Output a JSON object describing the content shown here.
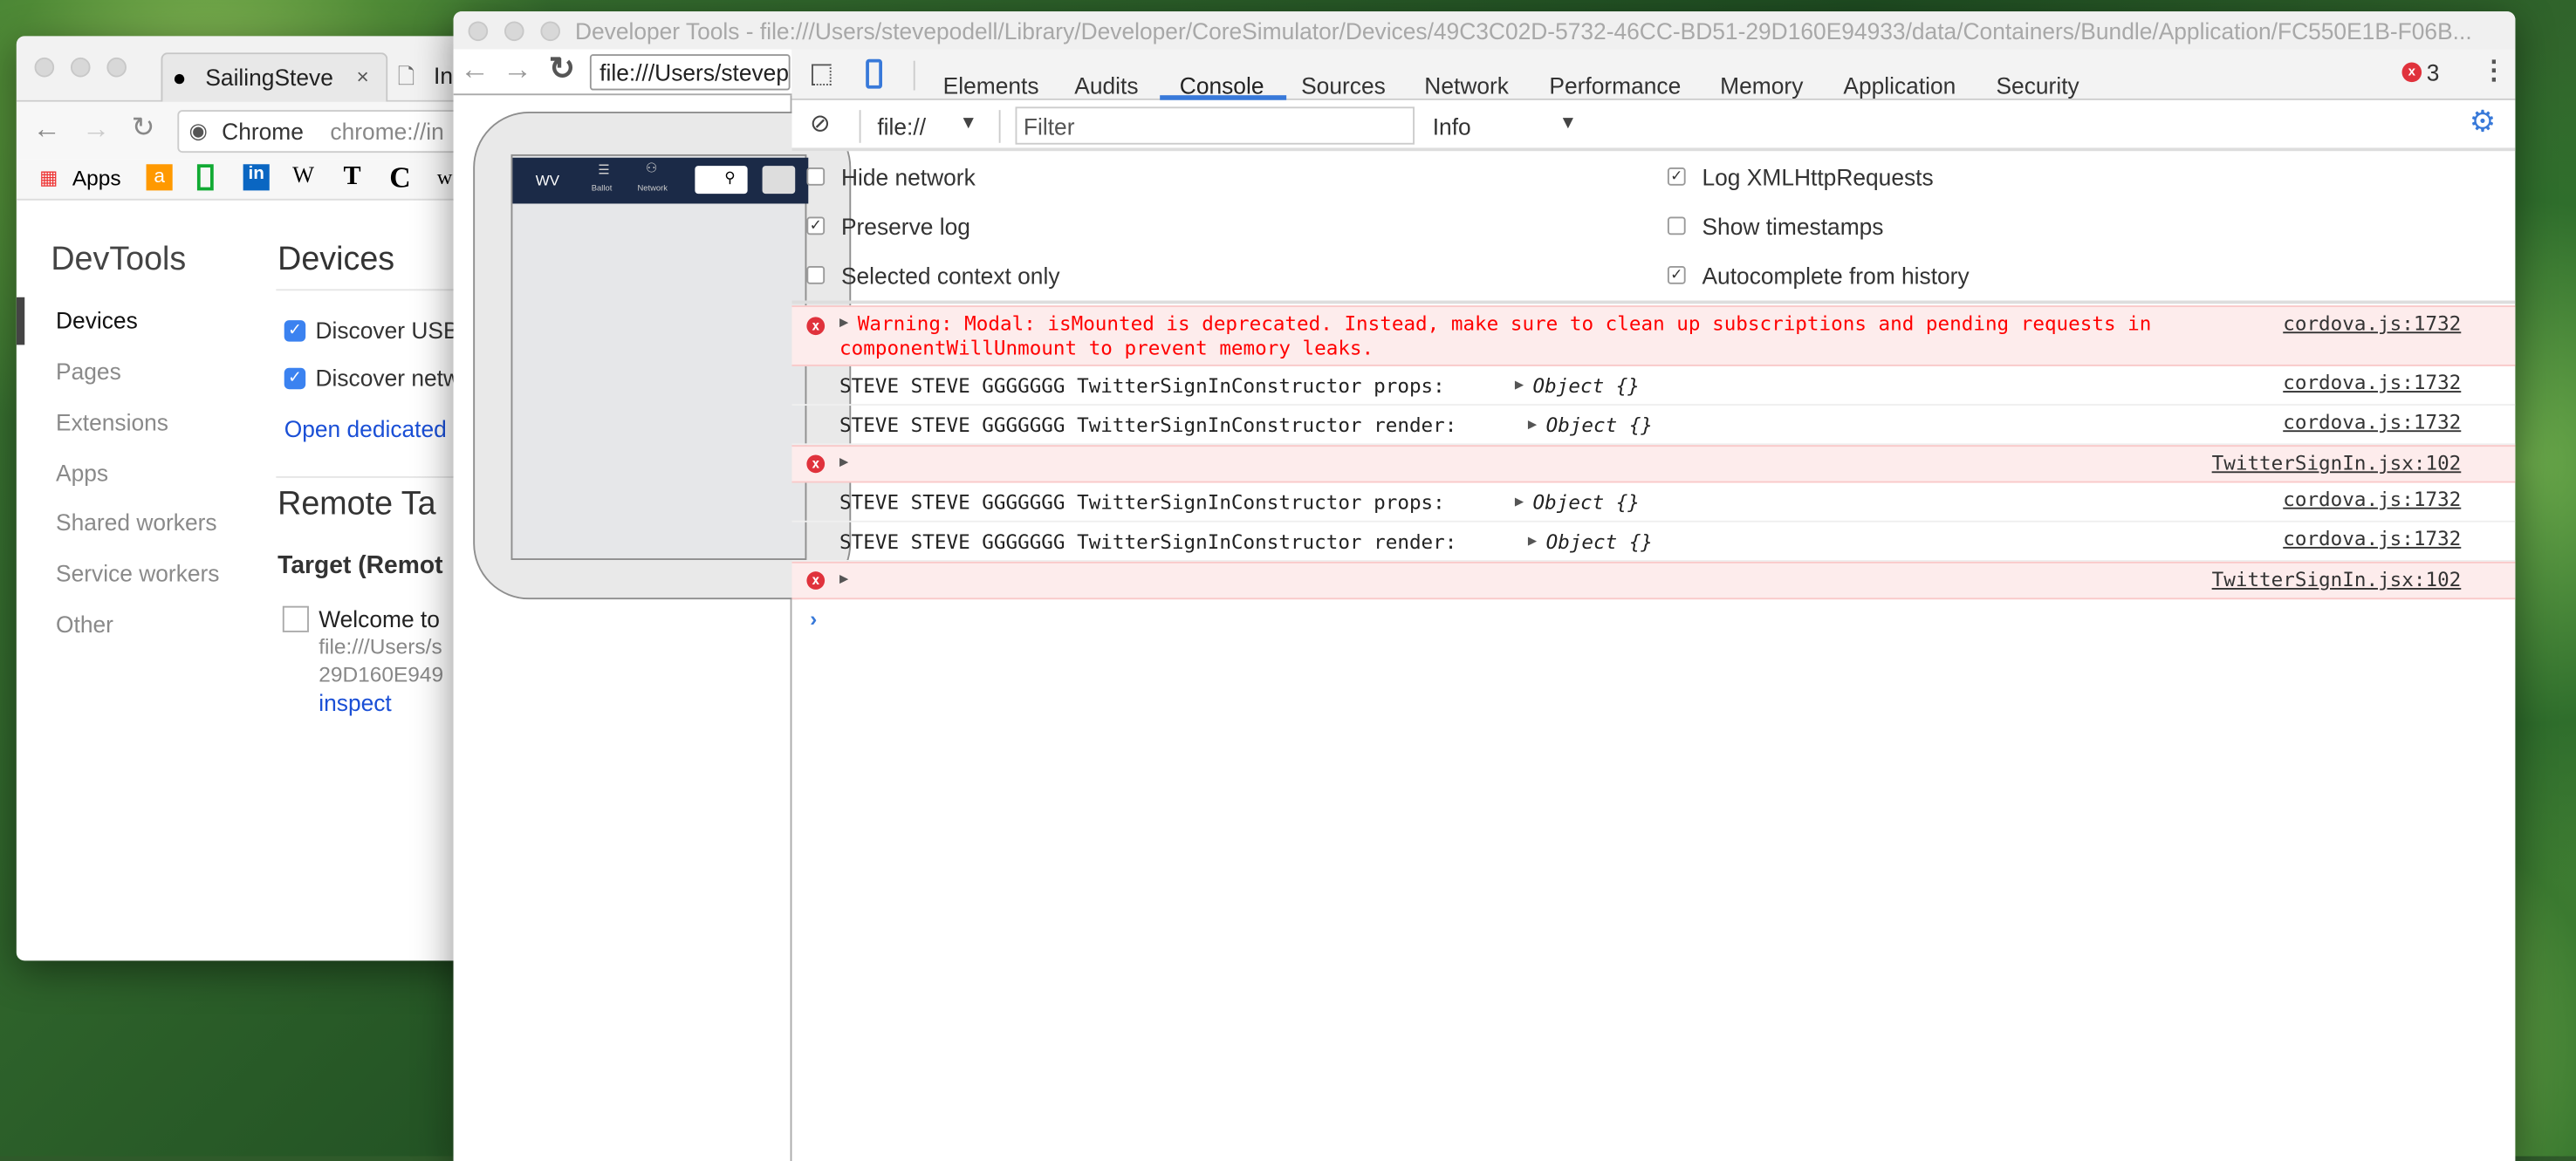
{
  "chrome_window": {
    "tabs": [
      {
        "label": "SailingSteve",
        "icon": "github-icon"
      },
      {
        "label": "Ins",
        "icon": "document-icon"
      }
    ],
    "omnibox": {
      "site_label": "Chrome",
      "url": "chrome://in"
    },
    "bookmarks": [
      {
        "label": "Apps",
        "icon": "apps-grid-icon"
      },
      {
        "label": "",
        "icon": "amazon-icon"
      },
      {
        "label": "",
        "icon": "green-bracket-icon"
      },
      {
        "label": "",
        "icon": "linkedin-icon"
      },
      {
        "label": "",
        "icon": "wikipedia-icon"
      },
      {
        "label": "",
        "icon": "nytimes-icon"
      },
      {
        "label": "",
        "icon": "c-logo-icon"
      },
      {
        "label": "",
        "icon": "wapo-icon"
      }
    ],
    "sidebar": {
      "title": "DevTools",
      "items": [
        {
          "label": "Devices",
          "selected": true
        },
        {
          "label": "Pages"
        },
        {
          "label": "Extensions"
        },
        {
          "label": "Apps"
        },
        {
          "label": "Shared workers"
        },
        {
          "label": "Service workers"
        },
        {
          "label": "Other"
        }
      ]
    },
    "main": {
      "title": "Devices",
      "discover_usb": "Discover USB",
      "discover_network": "Discover netw",
      "open_dedicated": "Open dedicated",
      "remote_title": "Remote Ta",
      "target_title": "Target (Remot",
      "target": {
        "title": "Welcome to",
        "url_line1": "file:///Users/s",
        "url_line2": "29D160E949",
        "inspect": "inspect"
      }
    }
  },
  "devtools_window": {
    "title": "Developer Tools - file:///Users/stevepodell/Library/Developer/CoreSimulator/Devices/49C3C02D-5732-46CC-BD51-29D160E94933/data/Containers/Bundle/Application/FC550E1B-F06B...",
    "screencast": {
      "url": "file:///Users/stevep",
      "app_nav": {
        "brand": "WV",
        "ballot": "Ballot",
        "network": "Network"
      }
    },
    "tabs": [
      "Elements",
      "Audits",
      "Console",
      "Sources",
      "Network",
      "Performance",
      "Memory",
      "Application",
      "Security"
    ],
    "active_tab": "Console",
    "error_count": "3",
    "accent": "#3879d9",
    "filter_bar": {
      "context": "file://",
      "filter_placeholder": "Filter",
      "level": "Info"
    },
    "settings": {
      "hide_network": {
        "label": "Hide network",
        "checked": false
      },
      "preserve_log": {
        "label": "Preserve log",
        "checked": true
      },
      "selected_context": {
        "label": "Selected context only",
        "checked": false
      },
      "log_xhr": {
        "label": "Log XMLHttpRequests",
        "checked": true
      },
      "show_timestamps": {
        "label": "Show timestamps",
        "checked": false
      },
      "autocomplete": {
        "label": "Autocomplete from history",
        "checked": true
      }
    },
    "messages": [
      {
        "type": "error",
        "text1": "Warning: Modal: isMounted is deprecated. Instead, make sure to clean up subscriptions and pending requests in",
        "text2": "componentWillUnmount to prevent memory leaks.",
        "source": "cordova.js:1732"
      },
      {
        "type": "log",
        "text": "STEVE STEVE GGGGGGG TwitterSignInConstructor props:",
        "object": "Object {}",
        "source": "cordova.js:1732"
      },
      {
        "type": "log",
        "text": "STEVE STEVE GGGGGGG TwitterSignInConstructor render:",
        "object": "Object {}",
        "source": "cordova.js:1732"
      },
      {
        "type": "error",
        "text": "",
        "source": "TwitterSignIn.jsx:102"
      },
      {
        "type": "log",
        "text": "STEVE STEVE GGGGGGG TwitterSignInConstructor props:",
        "object": "Object {}",
        "source": "cordova.js:1732"
      },
      {
        "type": "log",
        "text": "STEVE STEVE GGGGGGG TwitterSignInConstructor render:",
        "object": "Object {}",
        "source": "cordova.js:1732"
      },
      {
        "type": "error",
        "text": "",
        "source": "TwitterSignIn.jsx:102"
      }
    ]
  }
}
